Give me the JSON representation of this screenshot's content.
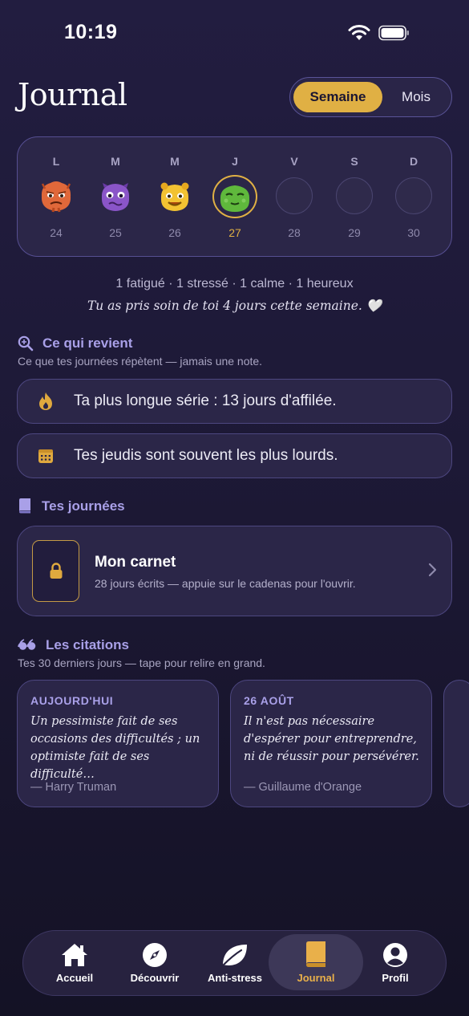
{
  "status": {
    "time": "10:19"
  },
  "header": {
    "title": "Journal",
    "segment": {
      "week": "Semaine",
      "month": "Mois",
      "selected": "Semaine"
    }
  },
  "week": {
    "days": [
      {
        "letter": "L",
        "num": "24",
        "mood": "fatigué",
        "color": "#e0683a"
      },
      {
        "letter": "M",
        "num": "25",
        "mood": "stressé",
        "color": "#8a55c8"
      },
      {
        "letter": "M",
        "num": "26",
        "mood": "heureux",
        "color": "#f2c232"
      },
      {
        "letter": "J",
        "num": "27",
        "mood": "calme",
        "color": "#5fb83c",
        "selected": true
      },
      {
        "letter": "V",
        "num": "28"
      },
      {
        "letter": "S",
        "num": "29"
      },
      {
        "letter": "D",
        "num": "30"
      }
    ],
    "summary": "1 fatigué · 1 stressé · 1 calme · 1 heureux",
    "note": "Tu as pris soin de toi 4 jours cette semaine. 🤍"
  },
  "recurring": {
    "title": "Ce qui revient",
    "subtitle": "Ce que tes journées répètent — jamais une note.",
    "items": [
      {
        "icon": "flame-icon",
        "text": "Ta plus longue série : 13 jours d'affilée."
      },
      {
        "icon": "calendar-icon",
        "text": "Tes jeudis sont souvent les plus lourds."
      }
    ]
  },
  "journeys": {
    "title": "Tes journées",
    "carnet_title": "Mon carnet",
    "carnet_sub": "28 jours écrits — appuie sur le cadenas pour l'ouvrir."
  },
  "quotes": {
    "title": "Les citations",
    "subtitle": "Tes 30 derniers jours — tape pour relire en grand.",
    "items": [
      {
        "date": "AUJOURD'HUI",
        "text": "Un pessimiste fait de ses occasions des difficultés ; un optimiste fait de ses difficulté…",
        "author": "— Harry Truman"
      },
      {
        "date": "26 AOÛT",
        "text": "Il n'est pas nécessaire d'espérer pour entreprendre, ni de réussir pour persévérer.",
        "author": "— Guillaume d'Orange"
      }
    ]
  },
  "tabs": [
    {
      "label": "Accueil",
      "icon": "home-icon"
    },
    {
      "label": "Découvrir",
      "icon": "compass-icon"
    },
    {
      "label": "Anti-stress",
      "icon": "leaf-icon"
    },
    {
      "label": "Journal",
      "icon": "book-icon",
      "active": true
    },
    {
      "label": "Profil",
      "icon": "profile-icon"
    }
  ],
  "colors": {
    "accent": "#e0b044",
    "section": "#a9a0e8",
    "card": "#2b2648"
  }
}
